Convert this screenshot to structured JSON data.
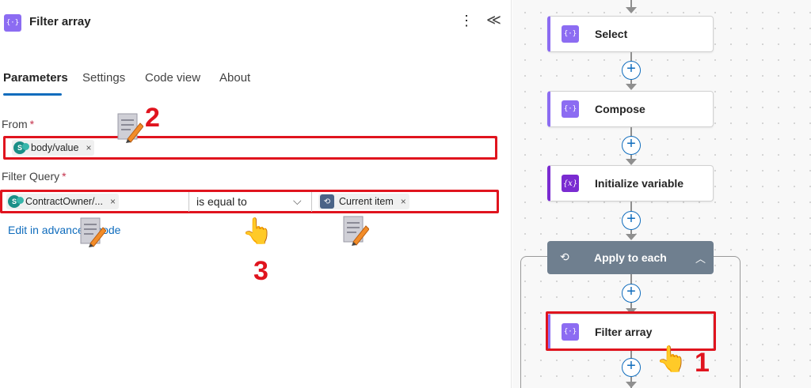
{
  "panel": {
    "icon_text": "{·}",
    "title": "Filter array",
    "more_glyph": "⋮",
    "collapse_glyph": "≪",
    "tabs": [
      {
        "label": "Parameters"
      },
      {
        "label": "Settings"
      },
      {
        "label": "Code view"
      },
      {
        "label": "About"
      }
    ],
    "from": {
      "label": "From",
      "required": "*",
      "token": {
        "text": "body/value",
        "icon": "sharepoint-icon",
        "remove": "×"
      }
    },
    "filter_query": {
      "label": "Filter Query",
      "required": "*",
      "left_token": {
        "text": "ContractOwner/...",
        "icon": "sharepoint-icon",
        "remove": "×"
      },
      "operator": "is equal to",
      "right_token": {
        "text": "Current item",
        "icon": "loop-icon",
        "remove": "×"
      }
    },
    "edit_advanced_link": "Edit in advanced mode"
  },
  "annotations": [
    "2",
    "3",
    "1"
  ],
  "canvas": {
    "cards": [
      {
        "label": "Select",
        "icon": "{·}"
      },
      {
        "label": "Compose",
        "icon": "{·}"
      },
      {
        "label": "Initialize variable",
        "icon": "{x}"
      }
    ],
    "scope": {
      "label": "Apply to each",
      "icon": "⟲"
    },
    "inner_card": {
      "label": "Filter array",
      "icon": "{·}"
    },
    "plus_glyph": "+"
  },
  "colors": {
    "accent": "#0f6cbd",
    "annotation": "#e0141e",
    "action_purple": "#8c6cf2",
    "sharepoint_teal": "#1a8f87"
  }
}
